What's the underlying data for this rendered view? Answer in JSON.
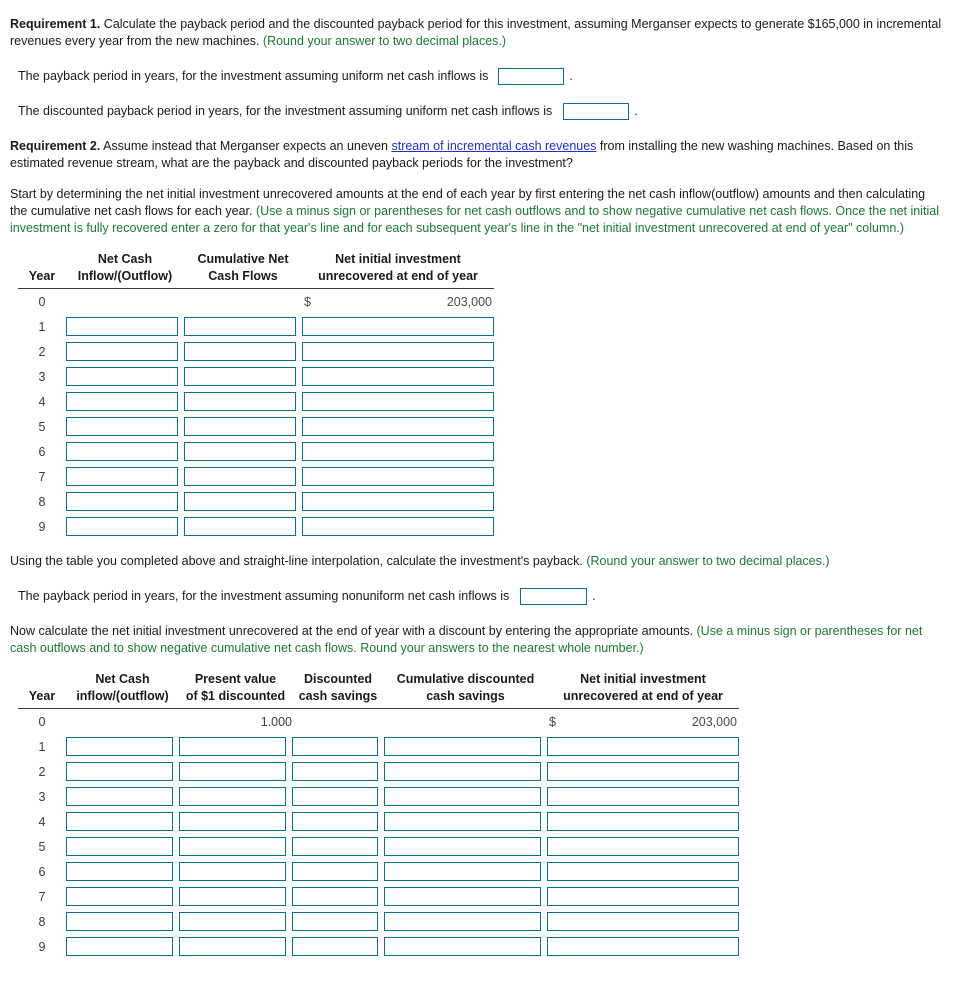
{
  "requirement1": {
    "label": "Requirement 1.",
    "body": " Calculate the payback period and the discounted payback period for this investment, assuming Merganser expects to generate $165,000 in incremental revenues every year from the new machines. ",
    "hint": "(Round your answer to two decimal places.)",
    "prompt1": "The payback period in years, for the investment assuming uniform net cash inflows is",
    "prompt2": "The discounted payback period in years, for the investment assuming uniform net cash inflows is",
    "answer1": "",
    "answer2": "",
    "period": "."
  },
  "requirement2": {
    "label": "Requirement 2.",
    "body_before_link": " Assume instead that Merganser expects an uneven ",
    "link_text": "stream of incremental cash revenues",
    "body_after_link": " from installing the new washing machines. Based on this estimated revenue stream, what are the payback and discounted payback periods for the investment?"
  },
  "instructions1": {
    "black_part": "Start by determining the net initial investment unrecovered amounts at the end of each year by first entering the net cash inflow(outflow) amounts and then calculating the cumulative net cash flows for each year. ",
    "green_part": "(Use a minus sign or parentheses for net cash outflows and to show negative cumulative net cash flows. Once the net initial investment is fully recovered enter a zero for that year's line and for each subsequent year's line in the \"net initial investment unrecovered at end of year\" column.)"
  },
  "table1": {
    "headers": [
      {
        "line1": "",
        "line2": "Year"
      },
      {
        "line1": "Net Cash",
        "line2": "Inflow/(Outflow)"
      },
      {
        "line1": "Cumulative Net",
        "line2": "Cash Flows"
      },
      {
        "line1": "Net initial investment",
        "line2": "unrecovered at end of year"
      }
    ],
    "row_zero": {
      "year": "0",
      "net_cash": "",
      "cumulative": "",
      "currency": "$",
      "unrecovered": "203,000"
    },
    "input_years": [
      "1",
      "2",
      "3",
      "4",
      "5",
      "6",
      "7",
      "8",
      "9"
    ]
  },
  "interpolation": {
    "black_part": "Using the table you completed above and straight-line interpolation, calculate the investment's payback. ",
    "green_part": "(Round your answer to two decimal places.)",
    "prompt": "The payback period in years, for the investment assuming nonuniform net cash inflows is",
    "answer": "",
    "period": "."
  },
  "instructions2": {
    "black_part": "Now calculate the net initial investment unrecovered at the end of year with a discount by entering the appropriate amounts. ",
    "green_part": "(Use a minus sign or parentheses for net cash outflows and to show negative cumulative net cash flows. Round your answers to the nearest whole number.)"
  },
  "table2": {
    "headers": [
      {
        "line1": "",
        "line2": "Year"
      },
      {
        "line1": "Net Cash",
        "line2": "inflow/(outflow)"
      },
      {
        "line1": "Present value",
        "line2": "of $1 discounted"
      },
      {
        "line1": "Discounted",
        "line2": "cash savings"
      },
      {
        "line1": "Cumulative discounted",
        "line2": "cash savings"
      },
      {
        "line1": "Net initial investment",
        "line2": "unrecovered at end of year"
      }
    ],
    "row_zero": {
      "year": "0",
      "net_cash": "",
      "pv_factor": "1.000",
      "discounted": "",
      "cumulative": "",
      "currency": "$",
      "unrecovered": "203,000"
    },
    "input_years": [
      "1",
      "2",
      "3",
      "4",
      "5",
      "6",
      "7",
      "8",
      "9"
    ]
  },
  "colors": {
    "green_text": "#1a7a33",
    "link_blue": "#1b31c9",
    "box_border": "#0b6f92",
    "body_text": "#1a1a1a"
  }
}
